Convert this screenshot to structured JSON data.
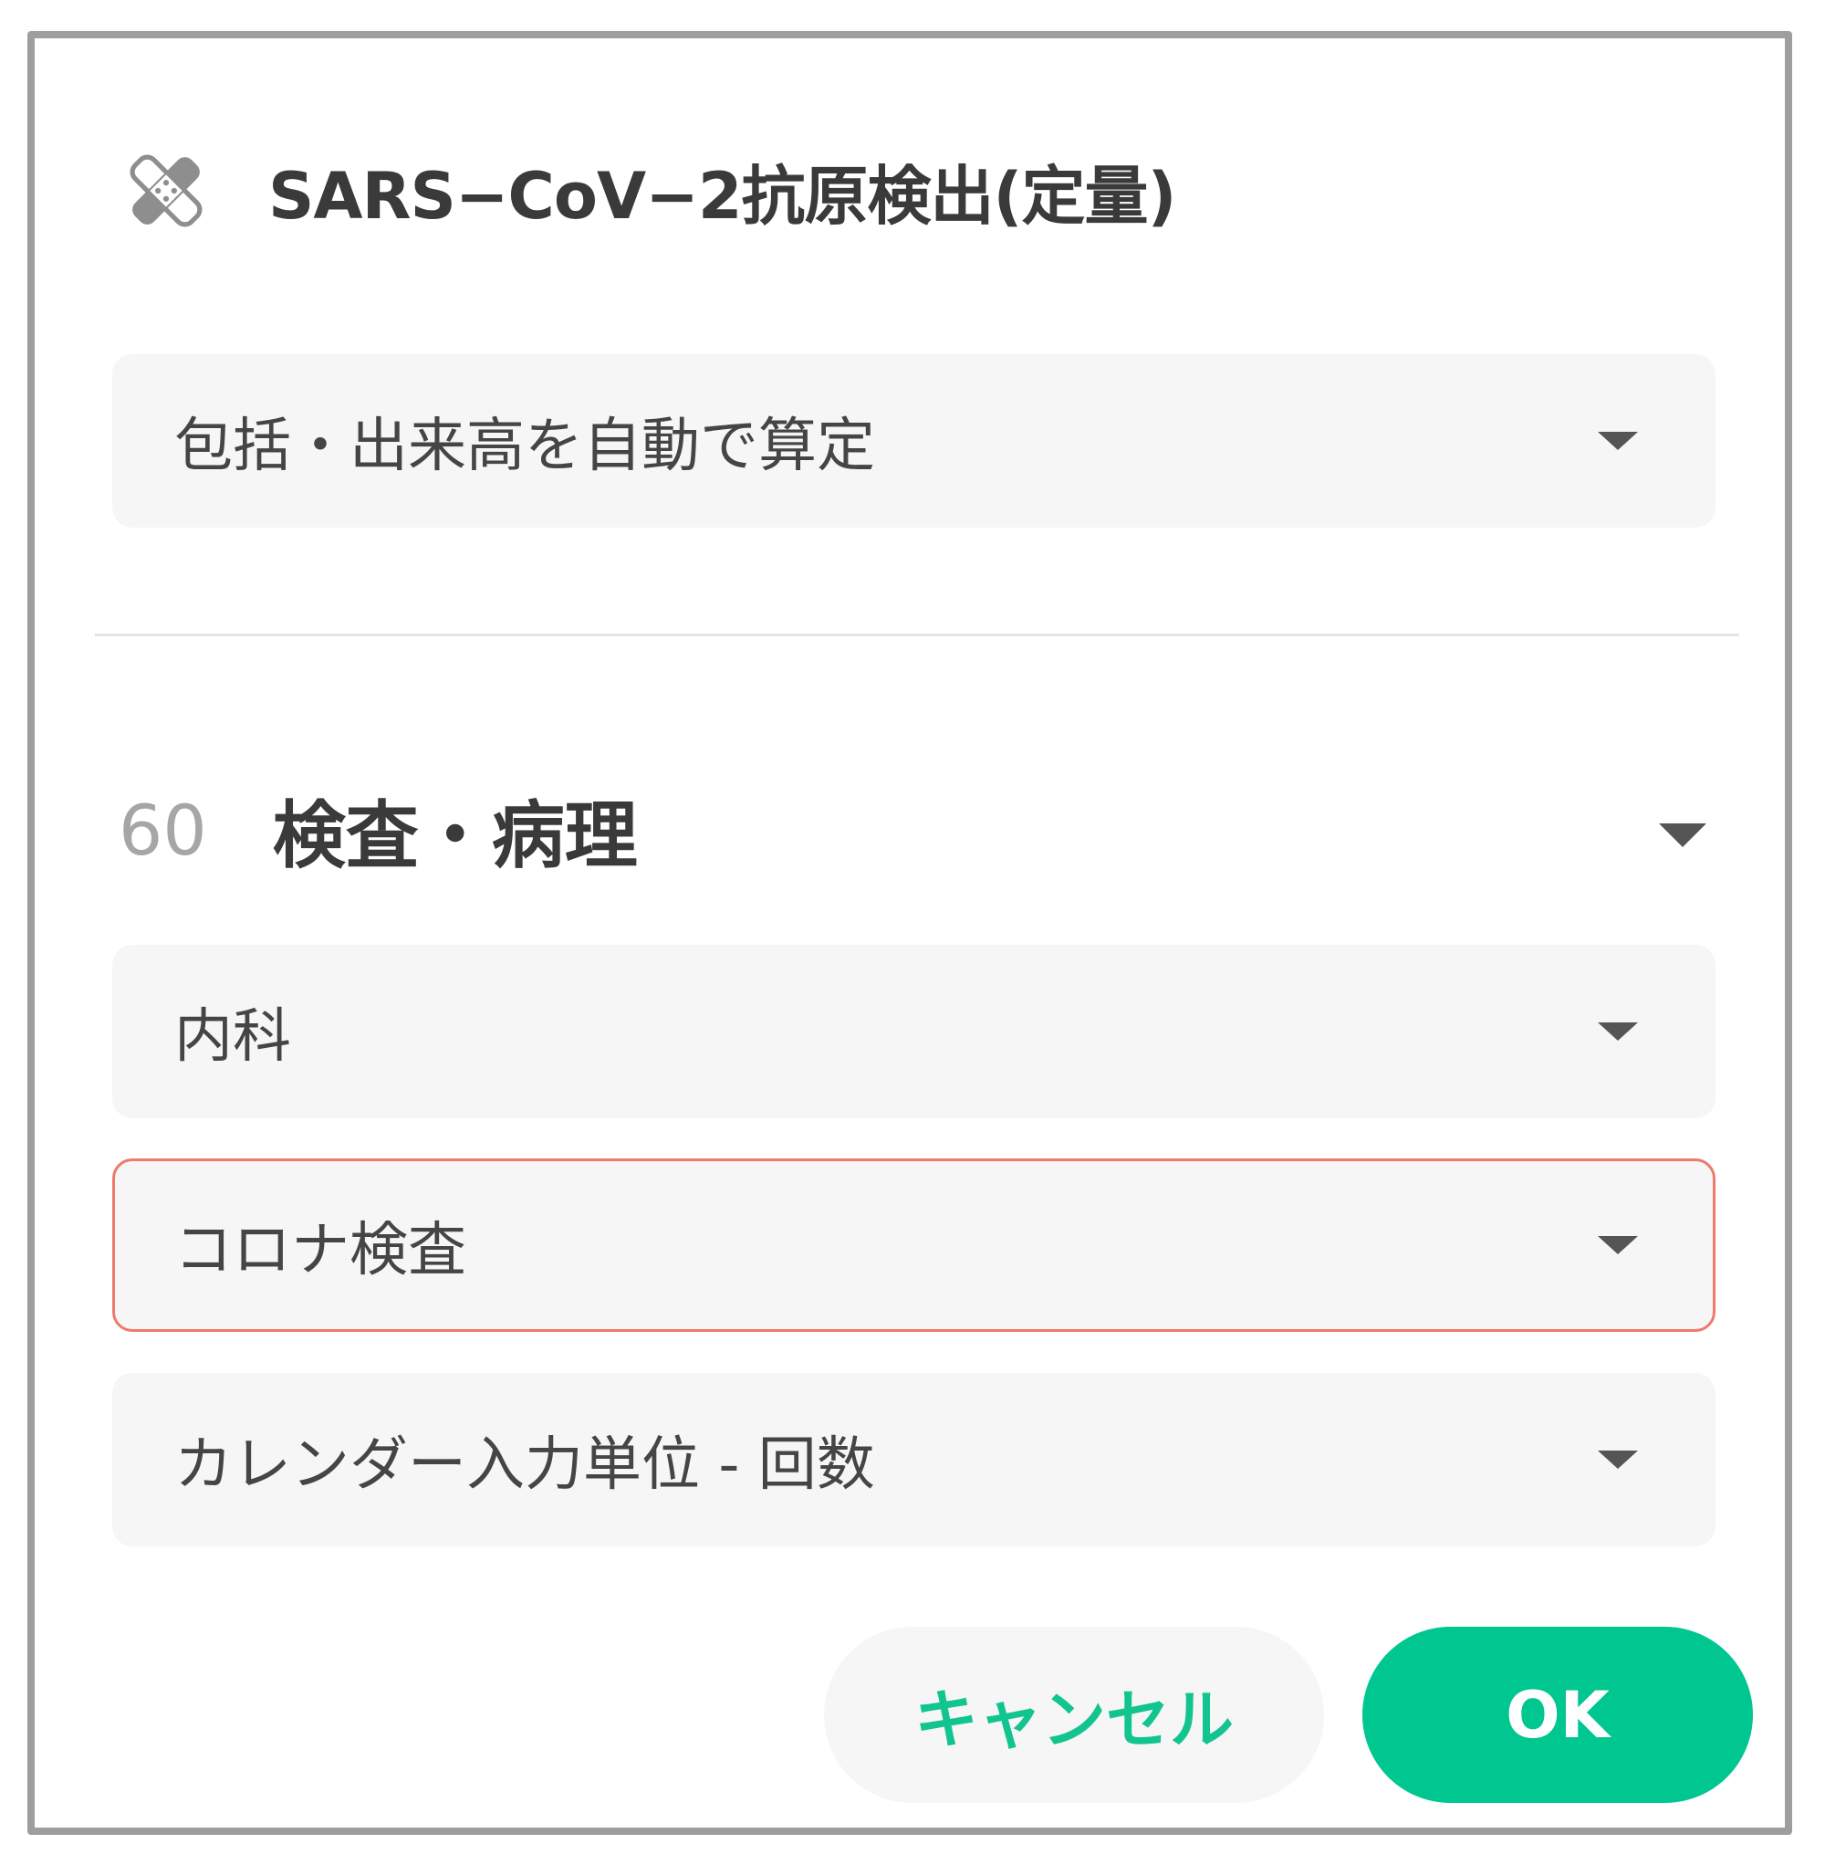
{
  "dialog": {
    "title": "SARS−CoV−2抗原検出(定量)",
    "title_icon": "bandage-icon"
  },
  "calc_select": {
    "value": "包括・出来高を自動で算定"
  },
  "section": {
    "code": "60",
    "name": "検査・病理"
  },
  "department_select": {
    "value": "内科"
  },
  "category_select": {
    "value": "コロナ検査",
    "state": "error"
  },
  "unit_select": {
    "value": "カレンダー入力単位 - 回数"
  },
  "buttons": {
    "cancel_label": "キャンセル",
    "ok_label": "OK"
  },
  "colors": {
    "accent": "#00c690",
    "error_border": "#ee7a6b",
    "frame": "#9e9e9e",
    "field_bg": "#f6f6f6"
  }
}
